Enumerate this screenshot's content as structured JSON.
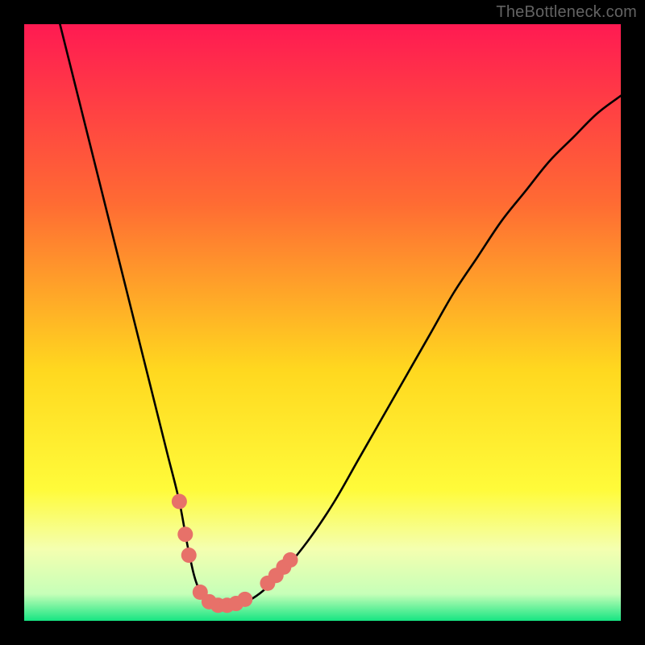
{
  "watermark": "TheBottleneck.com",
  "colors": {
    "gradient_top": "#ff1a52",
    "gradient_mid1": "#ff7a2a",
    "gradient_mid2": "#ffe91f",
    "gradient_mid3": "#f8ff6a",
    "gradient_bottom": "#16e582",
    "curve": "#000000",
    "markers_fill": "#e77169",
    "markers_stroke": "#b24d47"
  },
  "chart_data": {
    "type": "line",
    "title": "",
    "xlabel": "",
    "ylabel": "",
    "xlim": [
      0,
      100
    ],
    "ylim": [
      0,
      100
    ],
    "series": [
      {
        "name": "bottleneck-curve",
        "x": [
          6,
          8,
          10,
          12,
          14,
          16,
          18,
          20,
          22,
          24,
          26,
          27.5,
          29,
          31,
          33,
          35,
          37,
          40,
          44,
          48,
          52,
          56,
          60,
          64,
          68,
          72,
          76,
          80,
          84,
          88,
          92,
          96,
          100
        ],
        "y": [
          100,
          92,
          84,
          76,
          68,
          60,
          52,
          44,
          36,
          28,
          20,
          12,
          6,
          3,
          2,
          2,
          3,
          5,
          9,
          14,
          20,
          27,
          34,
          41,
          48,
          55,
          61,
          67,
          72,
          77,
          81,
          85,
          88
        ]
      }
    ],
    "markers": {
      "name": "highlighted-points",
      "points": [
        {
          "x": 26.0,
          "y": 20.0
        },
        {
          "x": 27.0,
          "y": 14.5
        },
        {
          "x": 27.6,
          "y": 11.0
        },
        {
          "x": 29.5,
          "y": 4.8
        },
        {
          "x": 31.0,
          "y": 3.2
        },
        {
          "x": 32.5,
          "y": 2.6
        },
        {
          "x": 34.0,
          "y": 2.6
        },
        {
          "x": 35.5,
          "y": 2.9
        },
        {
          "x": 37.0,
          "y": 3.6
        },
        {
          "x": 40.8,
          "y": 6.3
        },
        {
          "x": 42.2,
          "y": 7.6
        },
        {
          "x": 43.5,
          "y": 9.0
        },
        {
          "x": 44.6,
          "y": 10.2
        }
      ]
    },
    "grid": false,
    "legend": false
  }
}
